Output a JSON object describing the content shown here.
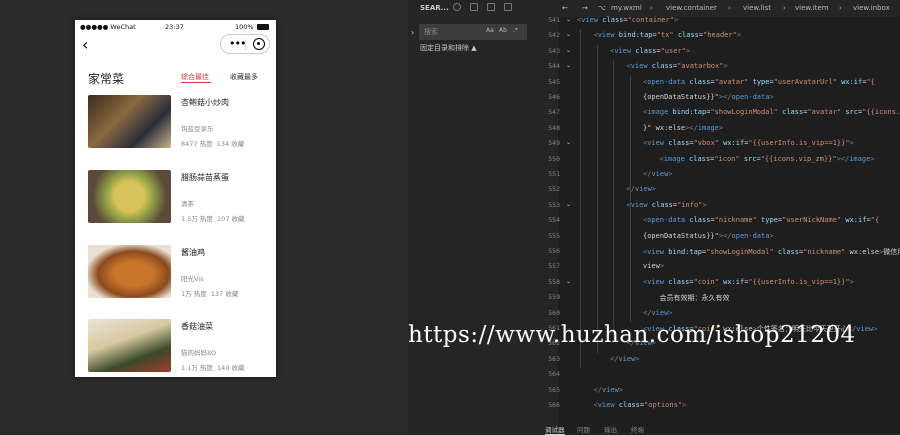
{
  "simulator": {
    "status": {
      "signal": "●●●●● WeChat",
      "time": "23:37",
      "battery": "100%"
    },
    "section_title": "家常菜",
    "tabs": [
      "综合最佳",
      "收藏最多"
    ],
    "items": [
      {
        "title": "杏鲍菇小炒肉",
        "author": "钩蓝豆享乐",
        "heat": "8477 热度",
        "fav": "134 收藏"
      },
      {
        "title": "腊肠蒜苗蒸蛋",
        "author": "清茶",
        "heat": "1.5万 热度",
        "fav": "107 收藏"
      },
      {
        "title": "酱油鸡",
        "author": "阳光Vis",
        "heat": "1万 热度",
        "fav": "137 收藏"
      },
      {
        "title": "香菇油菜",
        "author": "猫的妈妈XO",
        "heat": "1.1万 热度",
        "fav": "140 收藏"
      }
    ]
  },
  "panel": {
    "title": "SEAR...",
    "search_placeholder": "搜索",
    "search_options": [
      "Aa",
      "Ab",
      ".*"
    ],
    "fix_text": "固定目录和排除 ▲"
  },
  "breadcrumb": [
    "my.wxml",
    "view.container",
    "view.list",
    "view.item",
    "view.inbox"
  ],
  "code": {
    "lines": [
      "<view class=\"container\">",
      "<view bind:tap=\"tx\" class=\"header\">",
      "<view class=\"user\">",
      "<view class=\"avatarbox\">",
      "<open-data class=\"avatar\" type=\"userAvatarUrl\" wx:if=\"{",
      "{openDataStatus}}\"></open-data>",
      "<image bind:tap=\"showLoginModal\" class=\"avatar\" src=\"{{icons.d",
      "}\" wx:else></image>",
      "<view class=\"vbox\" wx:if=\"{{userInfo.is_vip==1}}\">",
      "<image class=\"icon\" src=\"{{icons.vip_zm}}\"></image>",
      "</view>",
      "</view>",
      "<view class=\"info\">",
      "<open-data class=\"nickname\" type=\"userNickName\" wx:if=\"{",
      "{openDataStatus}}\"></open-data>",
      "<view bind:tap=\"showLoginModal\" class=\"nickname\" wx:else>微信用",
      "view>",
      "<view class=\"coin\" wx:if=\"{{userInfo.is_vip==1}}\">",
      "会员有效期：永久有效",
      "</view>",
      "<view class=\"coin\" wx:else>个性签名：明天比今天更开心</view>",
      "</view>",
      "</view>",
      "",
      "</view>",
      "<view class=\"options\">"
    ]
  },
  "watermark": "https://www.huzhan.com/ishop21204",
  "bottom_tabs": [
    "调试器",
    "问题",
    "输出",
    "终端"
  ],
  "colors": {
    "accent": "#e4393c",
    "editor_bg": "#1e1e1e",
    "tag": "#569cd6",
    "attr": "#9cdcfe",
    "string": "#ce9178"
  }
}
